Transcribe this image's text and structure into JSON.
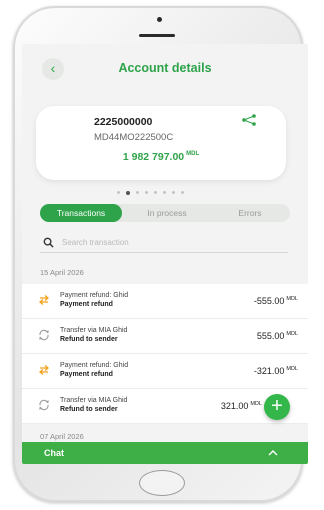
{
  "header": {
    "back_icon": "chevron-left-icon",
    "title": "Account details"
  },
  "account": {
    "number": "2225000000",
    "iban": "MD44MO222500C",
    "share_icon": "share-icon",
    "balance": "1 982 797.00",
    "currency": "MDL"
  },
  "carousel": {
    "dot_count": 8,
    "active_index": 1
  },
  "tabs": [
    {
      "label": "Transactions",
      "active": true
    },
    {
      "label": "In process",
      "active": false
    },
    {
      "label": "Errors",
      "active": false
    }
  ],
  "search": {
    "placeholder": "Search transaction",
    "icon": "search-icon"
  },
  "groups": [
    {
      "date": "15 April 2026",
      "transactions": [
        {
          "icon": "refund-arrow-icon",
          "line1": "Payment refund: Ghid",
          "line2": "Payment refund",
          "amount": "-555.00",
          "currency": "MDL"
        },
        {
          "icon": "transfer-cycle-icon",
          "line1": "Transfer via MIA Ghid",
          "line2": "Refund to sender",
          "amount": "555.00",
          "currency": "MDL"
        },
        {
          "icon": "refund-arrow-icon",
          "line1": "Payment refund: Ghid",
          "line2": "Payment refund",
          "amount": "-321.00",
          "currency": "MDL"
        },
        {
          "icon": "transfer-cycle-icon",
          "line1": "Transfer via MIA Ghid",
          "line2": "Refund to sender",
          "amount": "321.00",
          "currency": "MDL"
        }
      ]
    },
    {
      "date": "07 April 2026",
      "transactions": []
    }
  ],
  "fab": {
    "label": "+"
  },
  "chat": {
    "label": "Chat",
    "icon": "chevron-up-icon"
  },
  "colors": {
    "brand_green": "#2ea34a",
    "chat_green": "#3eae46",
    "refund_orange": "#f0a21a"
  }
}
